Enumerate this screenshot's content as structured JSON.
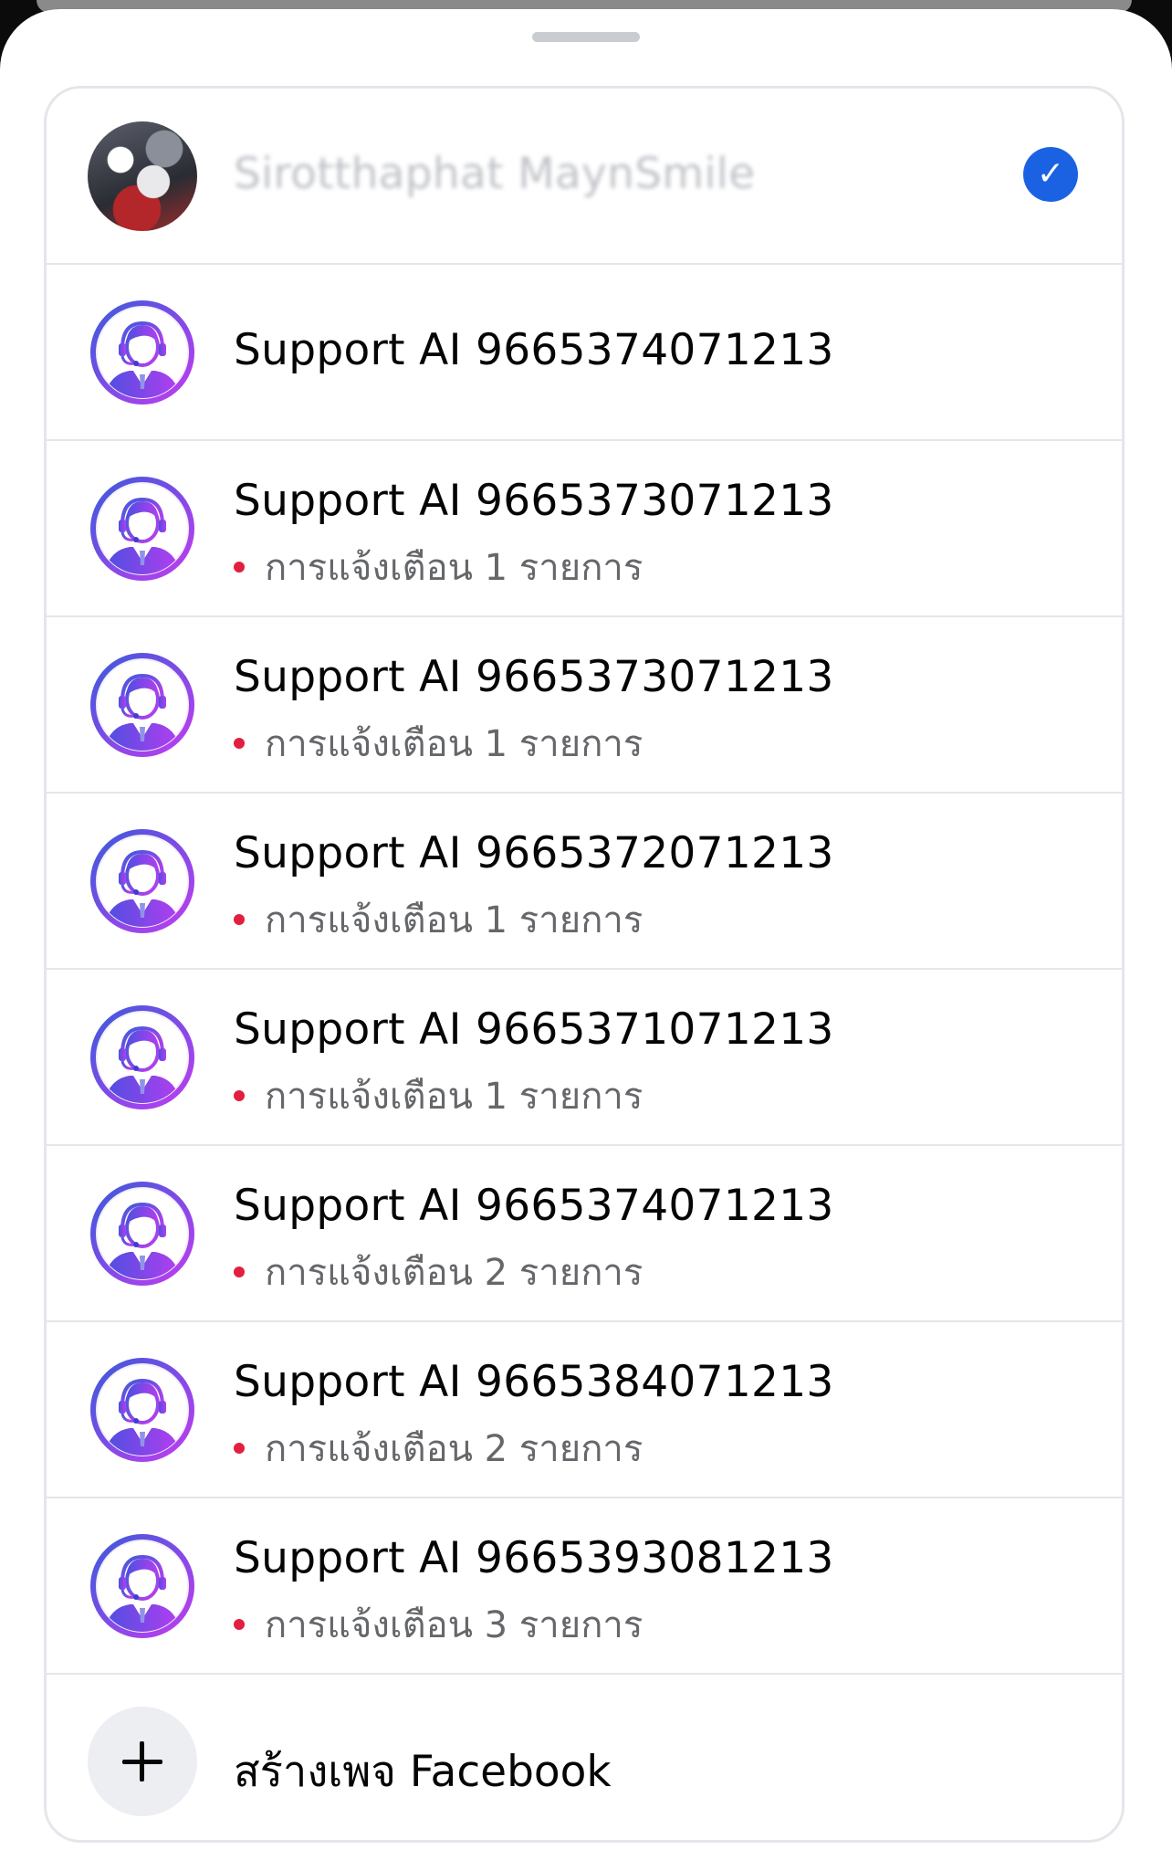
{
  "profile": {
    "name": "Sirotthaphat MaynSmile",
    "selected": true,
    "check_icon": "check-icon"
  },
  "pages": [
    {
      "name": "Support AI 9665374071213",
      "notification": null
    },
    {
      "name": "Support AI 9665373071213",
      "notification": "การแจ้งเตือน 1 รายการ"
    },
    {
      "name": "Support AI 9665373071213",
      "notification": "การแจ้งเตือน 1 รายการ"
    },
    {
      "name": "Support AI 9665372071213",
      "notification": "การแจ้งเตือน 1 รายการ"
    },
    {
      "name": "Support AI 9665371071213",
      "notification": "การแจ้งเตือน 1 รายการ"
    },
    {
      "name": "Support AI 9665374071213",
      "notification": "การแจ้งเตือน 2 รายการ"
    },
    {
      "name": "Support AI 9665384071213",
      "notification": "การแจ้งเตือน 2 รายการ"
    },
    {
      "name": "Support AI 9665393081213",
      "notification": "การแจ้งเตือน 3 รายการ"
    }
  ],
  "create_page": {
    "label": "สร้างเพจ Facebook",
    "icon": "plus-icon"
  },
  "colors": {
    "accent_blue": "#1b62e3",
    "notification_dot": "#e41e3f",
    "avatar_ring": "#7b2ff7"
  }
}
